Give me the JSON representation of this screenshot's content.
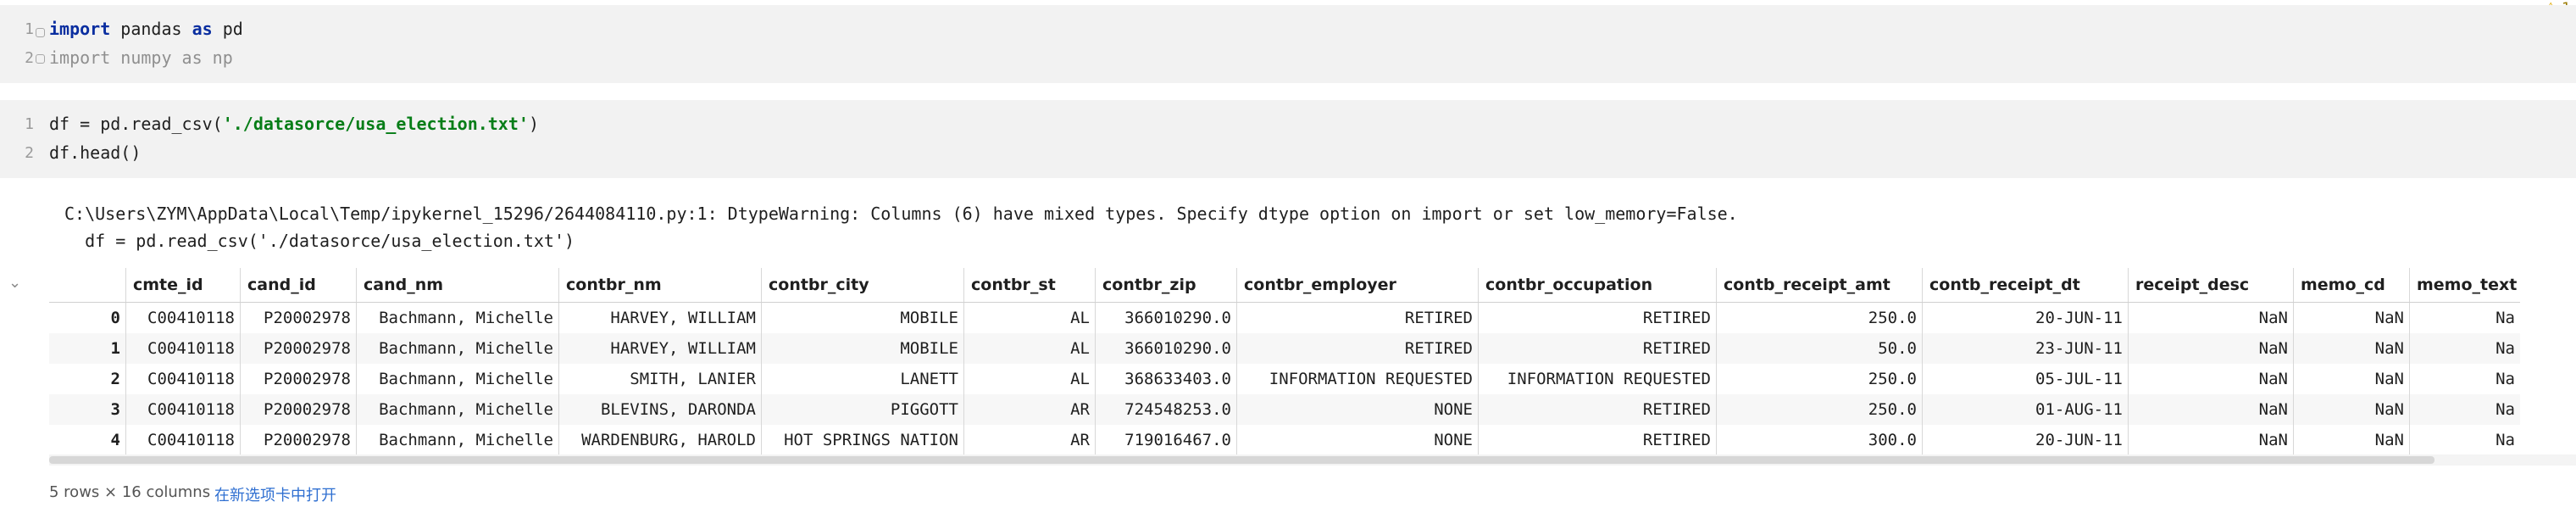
{
  "editor": {
    "warning_count": "1",
    "cell1": {
      "line_numbers": [
        "1",
        "2"
      ],
      "line1": {
        "kw1": "import",
        "t1": " pandas ",
        "kw2": "as",
        "t2": " pd"
      },
      "line2": {
        "kw1": "import",
        "t1": " numpy ",
        "kw2": "as",
        "t2": " np"
      }
    },
    "cell2": {
      "line_numbers": [
        "1",
        "2"
      ],
      "line1": {
        "t1": "df = pd.read_csv(",
        "str": "'./datasorce/usa_election.txt'",
        "t2": ")"
      },
      "line2": "df.head()"
    }
  },
  "output": {
    "warning_line1": "C:\\Users\\ZYM\\AppData\\Local\\Temp/ipykernel_15296/2644084110.py:1: DtypeWarning: Columns (6) have mixed types. Specify dtype option on import or set low_memory=False.",
    "warning_line2": "  df = pd.read_csv('./datasorce/usa_election.txt')",
    "table": {
      "columns": [
        "",
        "cmte_id",
        "cand_id",
        "cand_nm",
        "contbr_nm",
        "contbr_city",
        "contbr_st",
        "contbr_zip",
        "contbr_employer",
        "contbr_occupation",
        "contb_receipt_amt",
        "contb_receipt_dt",
        "receipt_desc",
        "memo_cd",
        "memo_text"
      ],
      "rows": [
        [
          "0",
          "C00410118",
          "P20002978",
          "Bachmann, Michelle",
          "HARVEY, WILLIAM",
          "MOBILE",
          "AL",
          "366010290.0",
          "RETIRED",
          "RETIRED",
          "250.0",
          "20-JUN-11",
          "NaN",
          "NaN",
          "Na"
        ],
        [
          "1",
          "C00410118",
          "P20002978",
          "Bachmann, Michelle",
          "HARVEY, WILLIAM",
          "MOBILE",
          "AL",
          "366010290.0",
          "RETIRED",
          "RETIRED",
          "50.0",
          "23-JUN-11",
          "NaN",
          "NaN",
          "Na"
        ],
        [
          "2",
          "C00410118",
          "P20002978",
          "Bachmann, Michelle",
          "SMITH, LANIER",
          "LANETT",
          "AL",
          "368633403.0",
          "INFORMATION REQUESTED",
          "INFORMATION REQUESTED",
          "250.0",
          "05-JUL-11",
          "NaN",
          "NaN",
          "Na"
        ],
        [
          "3",
          "C00410118",
          "P20002978",
          "Bachmann, Michelle",
          "BLEVINS, DARONDA",
          "PIGGOTT",
          "AR",
          "724548253.0",
          "NONE",
          "RETIRED",
          "250.0",
          "01-AUG-11",
          "NaN",
          "NaN",
          "Na"
        ],
        [
          "4",
          "C00410118",
          "P20002978",
          "Bachmann, Michelle",
          "WARDENBURG, HAROLD",
          "HOT SPRINGS NATION",
          "AR",
          "719016467.0",
          "NONE",
          "RETIRED",
          "300.0",
          "20-JUN-11",
          "NaN",
          "NaN",
          "Na"
        ]
      ]
    },
    "footer": {
      "rows_info": "5 rows × 16 columns",
      "open_in_tab": "在新选项卡中打开"
    }
  }
}
